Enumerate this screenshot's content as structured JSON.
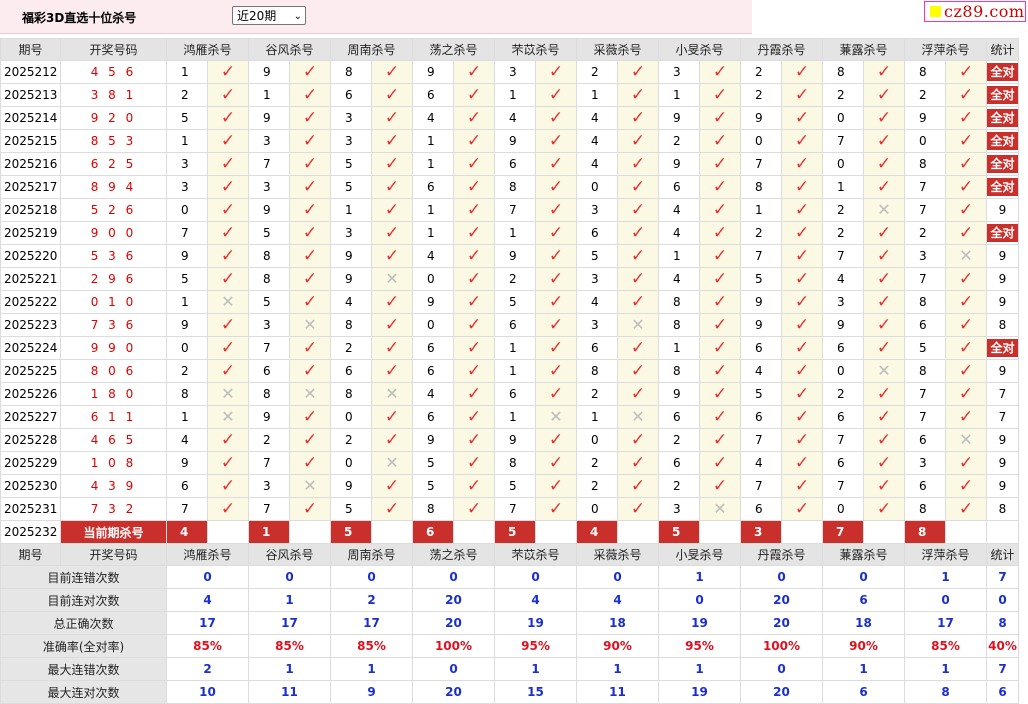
{
  "header": {
    "title": "福彩3D直选十位杀号",
    "period_select": "近20期",
    "logo_text": "cz89.com"
  },
  "columns": {
    "period": "期号",
    "draw": "开奖号码",
    "experts": [
      "鸿雁杀号",
      "谷风杀号",
      "周南杀号",
      "荡之杀号",
      "芣苡杀号",
      "采薇杀号",
      "小旻杀号",
      "丹霞杀号",
      "蒹露杀号",
      "浮萍杀号"
    ],
    "stat": "统计"
  },
  "rows": [
    {
      "period": "2025212",
      "draw": "4 5 6",
      "kills": [
        "1",
        "9",
        "8",
        "9",
        "3",
        "2",
        "3",
        "2",
        "8",
        "8"
      ],
      "hits": [
        true,
        true,
        true,
        true,
        true,
        true,
        true,
        true,
        true,
        true
      ],
      "stat": "全对"
    },
    {
      "period": "2025213",
      "draw": "3 8 1",
      "kills": [
        "2",
        "1",
        "6",
        "6",
        "1",
        "1",
        "1",
        "2",
        "2",
        "2"
      ],
      "hits": [
        true,
        true,
        true,
        true,
        true,
        true,
        true,
        true,
        true,
        true
      ],
      "stat": "全对"
    },
    {
      "period": "2025214",
      "draw": "9 2 0",
      "kills": [
        "5",
        "9",
        "3",
        "4",
        "4",
        "4",
        "9",
        "9",
        "0",
        "9"
      ],
      "hits": [
        true,
        true,
        true,
        true,
        true,
        true,
        true,
        true,
        true,
        true
      ],
      "stat": "全对"
    },
    {
      "period": "2025215",
      "draw": "8 5 3",
      "kills": [
        "1",
        "3",
        "3",
        "1",
        "9",
        "4",
        "2",
        "0",
        "7",
        "0"
      ],
      "hits": [
        true,
        true,
        true,
        true,
        true,
        true,
        true,
        true,
        true,
        true
      ],
      "stat": "全对"
    },
    {
      "period": "2025216",
      "draw": "6 2 5",
      "kills": [
        "3",
        "7",
        "5",
        "1",
        "6",
        "4",
        "9",
        "7",
        "0",
        "8"
      ],
      "hits": [
        true,
        true,
        true,
        true,
        true,
        true,
        true,
        true,
        true,
        true
      ],
      "stat": "全对"
    },
    {
      "period": "2025217",
      "draw": "8 9 4",
      "kills": [
        "3",
        "3",
        "5",
        "6",
        "8",
        "0",
        "6",
        "8",
        "1",
        "7"
      ],
      "hits": [
        true,
        true,
        true,
        true,
        true,
        true,
        true,
        true,
        true,
        true
      ],
      "stat": "全对"
    },
    {
      "period": "2025218",
      "draw": "5 2 6",
      "kills": [
        "0",
        "9",
        "1",
        "1",
        "7",
        "3",
        "4",
        "1",
        "2",
        "7"
      ],
      "hits": [
        true,
        true,
        true,
        true,
        true,
        true,
        true,
        true,
        false,
        true
      ],
      "stat": "9"
    },
    {
      "period": "2025219",
      "draw": "9 0 0",
      "kills": [
        "7",
        "5",
        "3",
        "1",
        "1",
        "6",
        "4",
        "2",
        "2",
        "2"
      ],
      "hits": [
        true,
        true,
        true,
        true,
        true,
        true,
        true,
        true,
        true,
        true
      ],
      "stat": "全对"
    },
    {
      "period": "2025220",
      "draw": "5 3 6",
      "kills": [
        "9",
        "8",
        "9",
        "4",
        "9",
        "5",
        "1",
        "7",
        "7",
        "3"
      ],
      "hits": [
        true,
        true,
        true,
        true,
        true,
        true,
        true,
        true,
        true,
        false
      ],
      "stat": "9"
    },
    {
      "period": "2025221",
      "draw": "2 9 6",
      "kills": [
        "5",
        "8",
        "9",
        "0",
        "2",
        "3",
        "4",
        "5",
        "4",
        "7"
      ],
      "hits": [
        true,
        true,
        false,
        true,
        true,
        true,
        true,
        true,
        true,
        true
      ],
      "stat": "9"
    },
    {
      "period": "2025222",
      "draw": "0 1 0",
      "kills": [
        "1",
        "5",
        "4",
        "9",
        "5",
        "4",
        "8",
        "9",
        "3",
        "8"
      ],
      "hits": [
        false,
        true,
        true,
        true,
        true,
        true,
        true,
        true,
        true,
        true
      ],
      "stat": "9"
    },
    {
      "period": "2025223",
      "draw": "7 3 6",
      "kills": [
        "9",
        "3",
        "8",
        "0",
        "6",
        "3",
        "8",
        "9",
        "9",
        "6"
      ],
      "hits": [
        true,
        false,
        true,
        true,
        true,
        false,
        true,
        true,
        true,
        true
      ],
      "stat": "8"
    },
    {
      "period": "2025224",
      "draw": "9 9 0",
      "kills": [
        "0",
        "7",
        "2",
        "6",
        "1",
        "6",
        "1",
        "6",
        "6",
        "5"
      ],
      "hits": [
        true,
        true,
        true,
        true,
        true,
        true,
        true,
        true,
        true,
        true
      ],
      "stat": "全对"
    },
    {
      "period": "2025225",
      "draw": "8 0 6",
      "kills": [
        "2",
        "6",
        "6",
        "6",
        "1",
        "8",
        "8",
        "4",
        "0",
        "8"
      ],
      "hits": [
        true,
        true,
        true,
        true,
        true,
        true,
        true,
        true,
        false,
        true
      ],
      "stat": "9"
    },
    {
      "period": "2025226",
      "draw": "1 8 0",
      "kills": [
        "8",
        "8",
        "8",
        "4",
        "6",
        "2",
        "9",
        "5",
        "2",
        "7"
      ],
      "hits": [
        false,
        false,
        false,
        true,
        true,
        true,
        true,
        true,
        true,
        true
      ],
      "stat": "7"
    },
    {
      "period": "2025227",
      "draw": "6 1 1",
      "kills": [
        "1",
        "9",
        "0",
        "6",
        "1",
        "1",
        "6",
        "6",
        "6",
        "7"
      ],
      "hits": [
        false,
        true,
        true,
        true,
        false,
        false,
        true,
        true,
        true,
        true
      ],
      "stat": "7"
    },
    {
      "period": "2025228",
      "draw": "4 6 5",
      "kills": [
        "4",
        "2",
        "2",
        "9",
        "9",
        "0",
        "2",
        "7",
        "7",
        "6"
      ],
      "hits": [
        true,
        true,
        true,
        true,
        true,
        true,
        true,
        true,
        true,
        false
      ],
      "stat": "9"
    },
    {
      "period": "2025229",
      "draw": "1 0 8",
      "kills": [
        "9",
        "7",
        "0",
        "5",
        "8",
        "2",
        "6",
        "4",
        "6",
        "3"
      ],
      "hits": [
        true,
        true,
        false,
        true,
        true,
        true,
        true,
        true,
        true,
        true
      ],
      "stat": "9"
    },
    {
      "period": "2025230",
      "draw": "4 3 9",
      "kills": [
        "6",
        "3",
        "9",
        "5",
        "5",
        "2",
        "2",
        "7",
        "7",
        "6"
      ],
      "hits": [
        true,
        false,
        true,
        true,
        true,
        true,
        true,
        true,
        true,
        true
      ],
      "stat": "9"
    },
    {
      "period": "2025231",
      "draw": "7 3 2",
      "kills": [
        "7",
        "7",
        "5",
        "8",
        "7",
        "0",
        "3",
        "6",
        "0",
        "8"
      ],
      "hits": [
        true,
        true,
        true,
        true,
        true,
        true,
        false,
        true,
        true,
        true
      ],
      "stat": "8"
    }
  ],
  "current": {
    "period": "2025232",
    "label": "当前期杀号",
    "kills": [
      "4",
      "1",
      "5",
      "6",
      "5",
      "4",
      "5",
      "3",
      "7",
      "8"
    ]
  },
  "stats": [
    {
      "label": "目前连错次数",
      "values": [
        "0",
        "0",
        "0",
        "0",
        "0",
        "0",
        "1",
        "0",
        "0",
        "1",
        "7"
      ]
    },
    {
      "label": "目前连对次数",
      "values": [
        "4",
        "1",
        "2",
        "20",
        "4",
        "4",
        "0",
        "20",
        "6",
        "0",
        "0"
      ]
    },
    {
      "label": "总正确次数",
      "values": [
        "17",
        "17",
        "17",
        "20",
        "19",
        "18",
        "19",
        "20",
        "18",
        "17",
        "8"
      ]
    },
    {
      "label": "准确率(全对率)",
      "values": [
        "85%",
        "85%",
        "85%",
        "100%",
        "95%",
        "90%",
        "95%",
        "100%",
        "90%",
        "85%",
        "40%"
      ]
    },
    {
      "label": "最大连错次数",
      "values": [
        "2",
        "1",
        "1",
        "0",
        "1",
        "1",
        "1",
        "0",
        "1",
        "1",
        "7"
      ]
    },
    {
      "label": "最大连对次数",
      "values": [
        "10",
        "11",
        "9",
        "20",
        "15",
        "11",
        "19",
        "20",
        "6",
        "8",
        "6"
      ]
    }
  ],
  "icons": {
    "hit": "check-icon",
    "miss": "cross-icon"
  },
  "colors": {
    "hit": "#e8302e",
    "miss": "#bdbdbd",
    "badge": "#c9302c",
    "stat_value": "#1a2fcc",
    "pct_value": "#e0101e"
  }
}
